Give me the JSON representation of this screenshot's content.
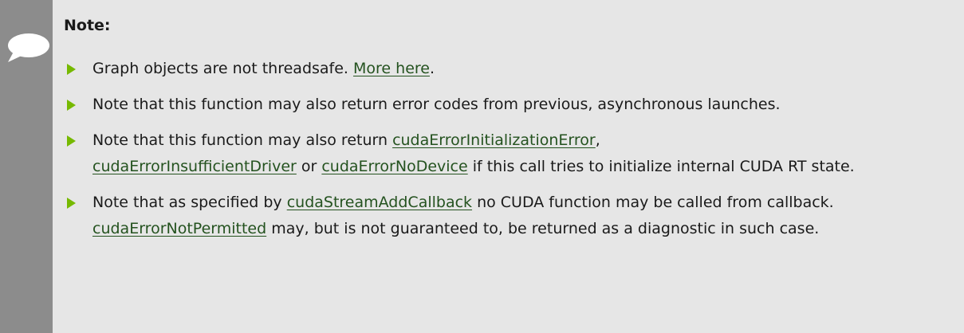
{
  "note": {
    "title": "Note:",
    "icon": "speech-bubble-icon",
    "colors": {
      "background": "#e6e6e6",
      "gutter": "#8c8c8c",
      "bullet": "#76b900",
      "link": "#24521f"
    },
    "items": [
      {
        "text_1": "Graph objects are not threadsafe. ",
        "link_1": "More here",
        "text_2": "."
      },
      {
        "text_1": "Note that this function may also return error codes from previous, asynchronous launches."
      },
      {
        "text_1": "Note that this function may also return ",
        "link_1": "cudaErrorInitializationError",
        "text_2": ", ",
        "link_2": "cudaErrorInsufficientDriver",
        "text_3": " or ",
        "link_3": "cudaErrorNoDevice",
        "text_4": " if this call tries to initialize internal CUDA RT state."
      },
      {
        "text_1": "Note that as specified by ",
        "link_1": "cudaStreamAddCallback",
        "text_2": " no CUDA function may be called from callback. ",
        "link_2": "cudaErrorNotPermitted",
        "text_3": " may, but is not guaranteed to, be returned as a diagnostic in such case."
      }
    ]
  }
}
